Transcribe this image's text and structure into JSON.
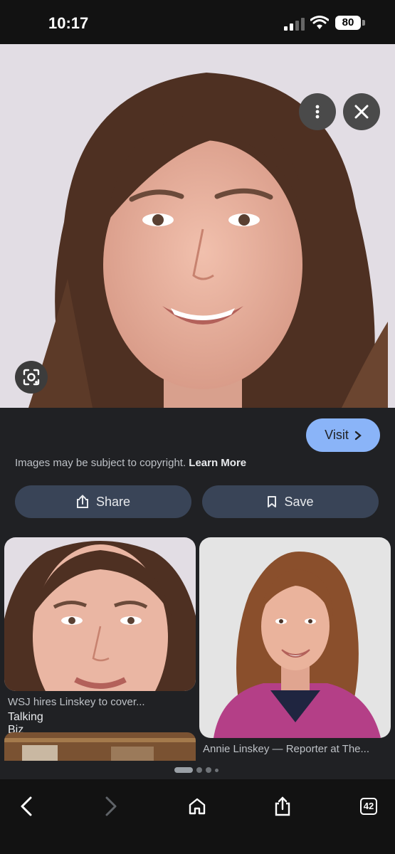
{
  "status_bar": {
    "time": "10:17",
    "battery": "80"
  },
  "viewer": {
    "more_icon": "more-vertical-icon",
    "close_icon": "close-icon",
    "lens_icon": "google-lens-icon"
  },
  "details": {
    "visit_label": "Visit",
    "copyright_text": "Images may be subject to copyright.",
    "learn_more_label": "Learn More",
    "share_label": "Share",
    "save_label": "Save"
  },
  "results": [
    {
      "title": "WSJ hires Linskey to cover...",
      "source": "Talking Biz News"
    },
    {
      "title": "Annie Linskey — Reporter at The...",
      "source": ""
    }
  ],
  "pager": {
    "pages": 4,
    "current": 1
  },
  "toolbar": {
    "tab_count": "42"
  },
  "colors": {
    "accent": "#8ab4f8",
    "button_bg": "#394457",
    "background": "#202124"
  }
}
